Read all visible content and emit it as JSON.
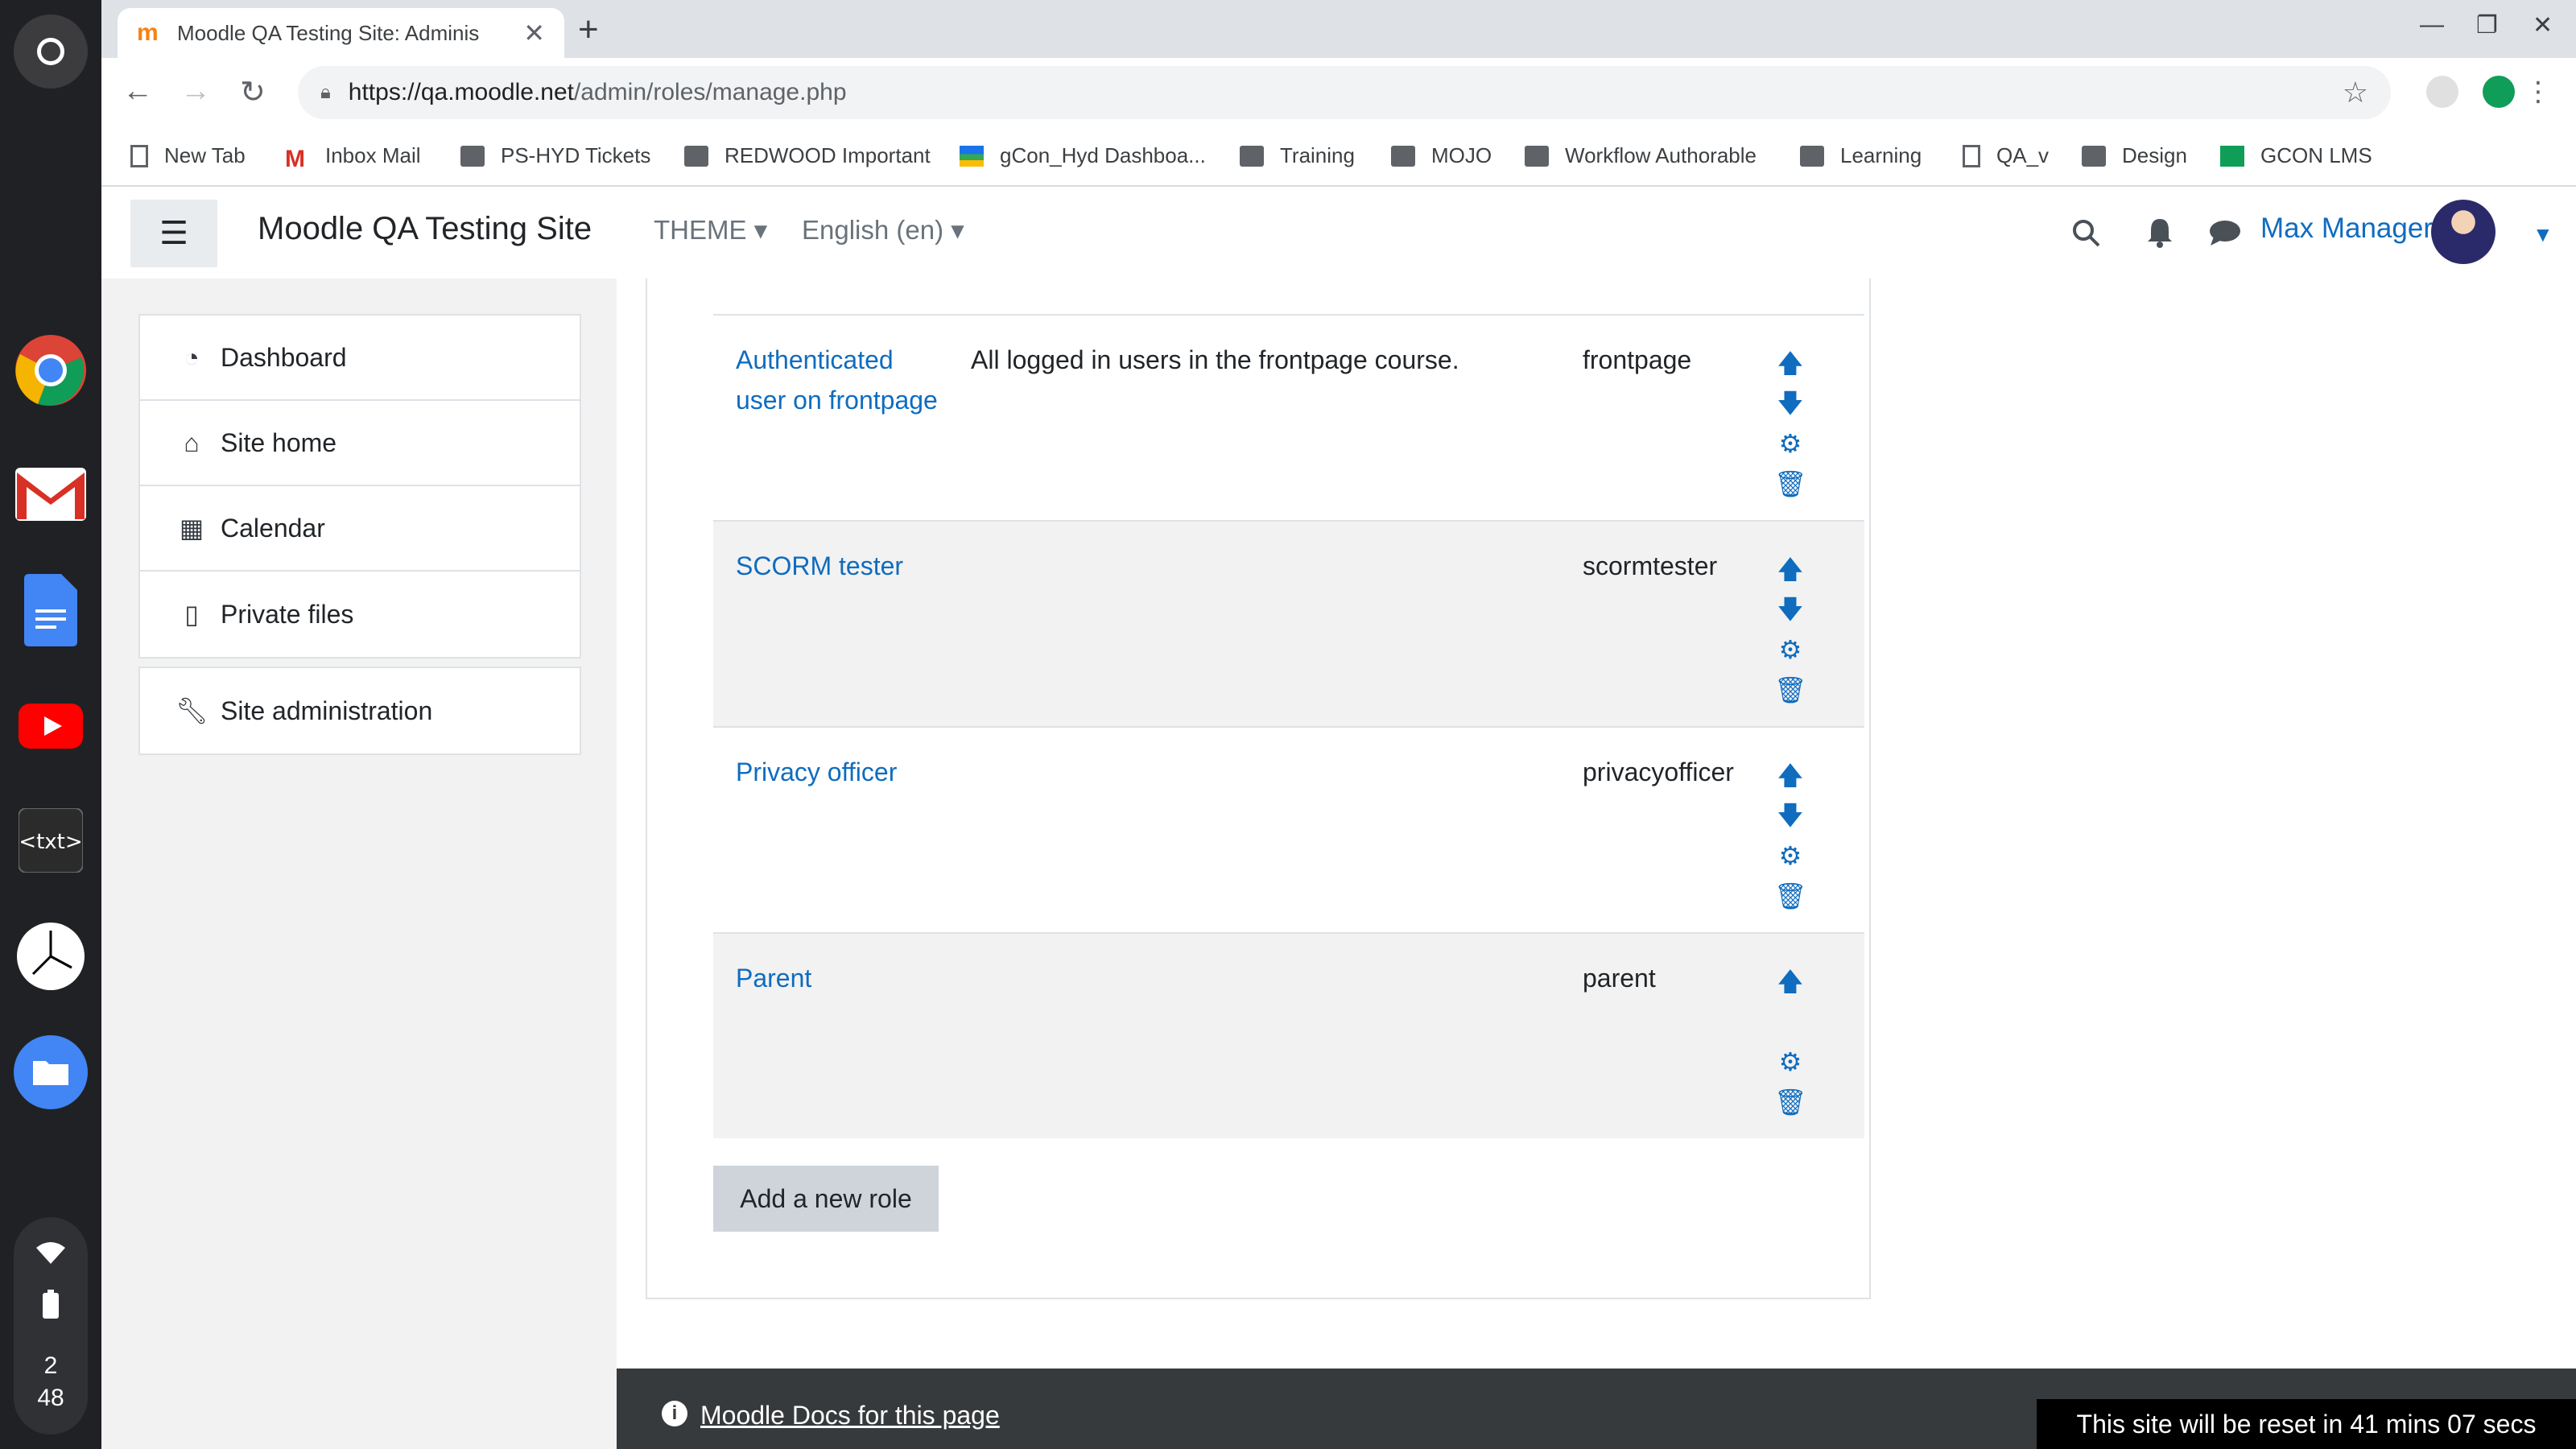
{
  "browser": {
    "tab_title": "Moodle QA Testing Site: Adminis",
    "url_host": "https://qa.moodle.net",
    "url_path": "/admin/roles/manage.php",
    "bookmarks": [
      {
        "label": "New Tab",
        "icon": "page-icon"
      },
      {
        "label": "Inbox Mail",
        "icon": "gmail-icon"
      },
      {
        "label": "PS-HYD Tickets",
        "icon": "folder-icon"
      },
      {
        "label": "REDWOOD Important",
        "icon": "folder-icon"
      },
      {
        "label": "gCon_Hyd Dashboa...",
        "icon": "dashboard-icon"
      },
      {
        "label": "Training",
        "icon": "folder-icon"
      },
      {
        "label": "MOJO",
        "icon": "folder-icon"
      },
      {
        "label": "Workflow Authorable",
        "icon": "folder-icon"
      },
      {
        "label": "Learning",
        "icon": "folder-icon"
      },
      {
        "label": "QA_v",
        "icon": "page-icon"
      },
      {
        "label": "Design",
        "icon": "folder-icon"
      },
      {
        "label": "GCON LMS",
        "icon": "classroom-icon"
      }
    ],
    "extension_badge": "1"
  },
  "shelf": {
    "clock_hour": "2",
    "clock_minute": "48"
  },
  "moodle": {
    "site_name": "Moodle QA Testing Site",
    "theme_menu": "THEME",
    "language_menu": "English (en)",
    "user_name": "Max Manager"
  },
  "drawer": {
    "items": [
      {
        "label": "Dashboard",
        "icon": "dashboard-icon"
      },
      {
        "label": "Site home",
        "icon": "home-icon"
      },
      {
        "label": "Calendar",
        "icon": "calendar-icon"
      },
      {
        "label": "Private files",
        "icon": "file-icon"
      }
    ],
    "admin_item": {
      "label": "Site administration",
      "icon": "wrench-icon"
    }
  },
  "roles": [
    {
      "name": "Authenticated user on frontpage",
      "description": "All logged in users in the frontpage course.",
      "short_name": "frontpage",
      "actions": [
        "up",
        "down",
        "edit",
        "delete"
      ]
    },
    {
      "name": "SCORM tester",
      "description": "",
      "short_name": "scormtester",
      "actions": [
        "up",
        "down",
        "edit",
        "delete"
      ]
    },
    {
      "name": "Privacy officer",
      "description": "",
      "short_name": "privacyofficer",
      "actions": [
        "up",
        "down",
        "edit",
        "delete"
      ]
    },
    {
      "name": "Parent",
      "description": "",
      "short_name": "parent",
      "actions": [
        "up",
        "edit",
        "delete"
      ]
    }
  ],
  "add_button": "Add a new role",
  "footer": {
    "docs_link": "Moodle Docs for this page",
    "reset_notice": "This site will be reset in 41 mins 07 secs"
  },
  "colors": {
    "link": "#0f6cbf",
    "footer_bg": "#373a3c",
    "row_alt": "#f2f2f2"
  }
}
